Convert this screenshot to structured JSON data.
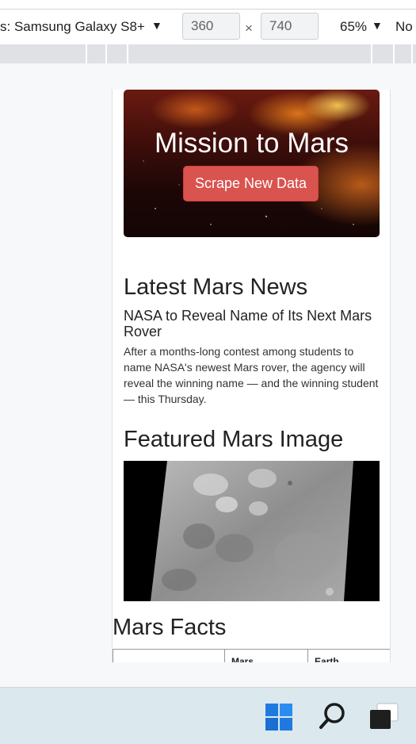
{
  "devtools": {
    "device_label": "s: Samsung Galaxy S8+",
    "width_value": "360",
    "height_value": "740",
    "dimension_separator": "×",
    "zoom": "65%",
    "throttling": "No"
  },
  "page": {
    "title": "Mission to Mars",
    "scrape_button": "Scrape New Data",
    "news_section_title": "Latest Mars News",
    "news_title": "NASA to Reveal Name of Its Next Mars Rover",
    "news_paragraph": "After a months-long contest among students to name NASA's newest Mars rover, the agency will reveal the winning name — and the winning student — this Thursday.",
    "image_section_title": "Featured Mars Image",
    "facts_section_title": "Mars Facts",
    "facts_table_headers": [
      "",
      "Mars",
      "Earth"
    ]
  },
  "colors": {
    "button_red": "#d9534f",
    "taskbar_bg": "#dbe9ee",
    "windows_blue": "#1f7ae0"
  },
  "icons": [
    "dropdown-caret-icon",
    "windows-start-icon",
    "search-icon",
    "task-view-icon"
  ]
}
